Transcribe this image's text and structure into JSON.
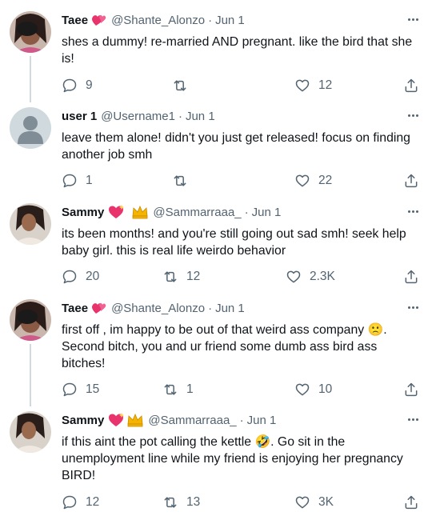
{
  "colors": {
    "text": "#0f1419",
    "muted": "#536471",
    "line": "#cfd9de"
  },
  "tweets": [
    {
      "name": "Taee",
      "handle": "@Shante_Alonzo",
      "date": "Jun 1",
      "badges": [
        "heart"
      ],
      "text": "shes a dummy! re-married AND pregnant. like the bird that she is!",
      "reply": "9",
      "retweet": "",
      "like": "12",
      "avatar_icon": "photo"
    },
    {
      "name": "user 1",
      "handle": "@Username1",
      "date": "Jun 1",
      "badges": [],
      "text": "leave them alone! didn't you just get released! focus on finding another job smh",
      "reply": "1",
      "retweet": "",
      "like": "22",
      "avatar_icon": "default-person"
    },
    {
      "name": "Sammy",
      "handle": "@Sammarraaa_",
      "date": "Jun 1",
      "badges": [
        "heart",
        "crown"
      ],
      "text": "its been months! and you're still going out sad smh! seek help baby girl. this is real life weirdo behavior",
      "reply": "20",
      "retweet": "12",
      "like": "2.3K",
      "avatar_icon": "photo"
    },
    {
      "name": "Taee",
      "handle": "@Shante_Alonzo",
      "date": "Jun 1",
      "badges": [
        "heart"
      ],
      "text": "first off , im happy to be out of that weird ass company 🙁. Second bitch, you and ur friend some dumb ass bird ass bitches!",
      "reply": "15",
      "retweet": "1",
      "like": "10",
      "avatar_icon": "photo"
    },
    {
      "name": "Sammy",
      "handle": "@Sammarraaa_",
      "date": "Jun 1",
      "badges": [
        "heart",
        "crown"
      ],
      "text": "if this aint the pot calling the kettle 🤣. Go sit in the unemployment line while my friend is enjoying her pregnancy BIRD!",
      "reply": "12",
      "retweet": "13",
      "like": "3K",
      "avatar_icon": "photo"
    }
  ]
}
